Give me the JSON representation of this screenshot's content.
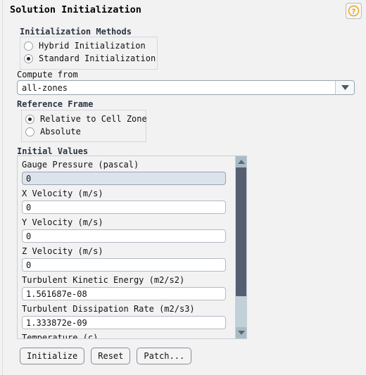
{
  "panel": {
    "title": "Solution Initialization",
    "help_icon": "help-question-icon"
  },
  "initialization_methods": {
    "label": "Initialization Methods",
    "options": [
      {
        "label": "Hybrid  Initialization",
        "selected": false
      },
      {
        "label": "Standard Initialization",
        "selected": true
      }
    ]
  },
  "compute_from": {
    "label": "Compute from",
    "value": "all-zones",
    "arrow_icon": "chevron-down-icon"
  },
  "reference_frame": {
    "label": "Reference Frame",
    "options": [
      {
        "label": "Relative to Cell Zone",
        "selected": true
      },
      {
        "label": "Absolute",
        "selected": false
      }
    ]
  },
  "initial_values": {
    "label": "Initial Values",
    "fields": [
      {
        "label": "Gauge Pressure (pascal)",
        "value": "0",
        "focused": true
      },
      {
        "label": "X Velocity (m/s)",
        "value": "0",
        "focused": false
      },
      {
        "label": "Y Velocity (m/s)",
        "value": "0",
        "focused": false
      },
      {
        "label": "Z Velocity (m/s)",
        "value": "0",
        "focused": false
      },
      {
        "label": "Turbulent Kinetic Energy (m2/s2)",
        "value": "1.561687e-08",
        "focused": false
      },
      {
        "label": "Turbulent Dissipation Rate (m2/s3)",
        "value": "1.333872e-09",
        "focused": false
      }
    ],
    "partial_field_label": "Temperature (c)",
    "scrollbar": {
      "up_icon": "scroll-up-arrow-icon",
      "down_icon": "scroll-down-arrow-icon"
    }
  },
  "actions": {
    "initialize": "Initialize",
    "reset": "Reset",
    "patch": "Patch..."
  },
  "colors": {
    "background": "#f2f2f2",
    "group_label": "#2b3443",
    "focus_field": "#dde3ed",
    "scroll_thumb": "#565f72",
    "help_accent": "#e8a317"
  }
}
